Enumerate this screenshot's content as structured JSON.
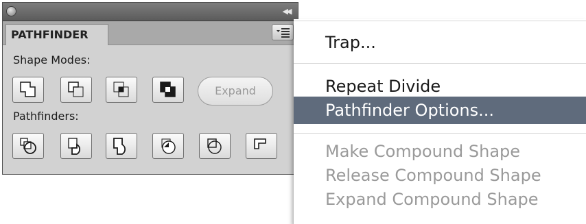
{
  "panel": {
    "tab_label": "PATHFINDER",
    "shape_modes_label": "Shape Modes:",
    "pathfinders_label": "Pathfinders:",
    "expand_label": "Expand",
    "shape_mode_icons": [
      "unite-icon",
      "minus-front-icon",
      "intersect-icon",
      "exclude-icon"
    ],
    "pathfinder_icons": [
      "divide-icon",
      "trim-icon",
      "merge-icon",
      "crop-icon",
      "outline-icon",
      "minus-back-icon"
    ]
  },
  "menu": {
    "items": [
      {
        "label": "Trap...",
        "state": "enabled"
      },
      {
        "label": "Repeat Divide",
        "state": "enabled"
      },
      {
        "label": "Pathfinder Options...",
        "state": "selected"
      },
      {
        "label": "Make Compound Shape",
        "state": "disabled"
      },
      {
        "label": "Release Compound Shape",
        "state": "disabled"
      },
      {
        "label": "Expand Compound Shape",
        "state": "disabled"
      }
    ]
  },
  "colors": {
    "selection_highlight": "#5f6b7c",
    "disabled_text": "#9a9a9a"
  }
}
